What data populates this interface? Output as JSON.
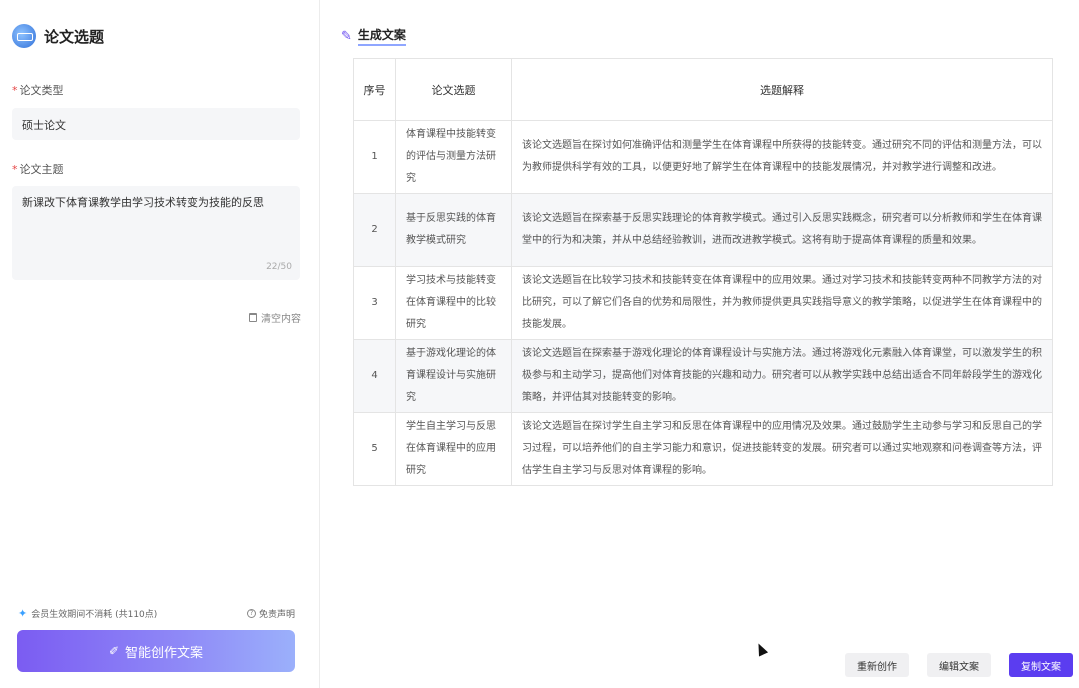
{
  "app": {
    "title": "论文选题"
  },
  "form": {
    "type_label": "论文类型",
    "type_value": "硕士论文",
    "topic_label": "论文主题",
    "topic_value": "新课改下体育课教学由学习技术转变为技能的反思",
    "counter": "22/50",
    "clear_label": "清空内容"
  },
  "footer": {
    "member_note": "会员生效期间不消耗 (共110点)",
    "disclaimer": "免责声明",
    "create_button": "智能创作文案"
  },
  "result": {
    "title": "生成文案",
    "columns": [
      "序号",
      "论文选题",
      "选题解释"
    ],
    "rows": [
      {
        "idx": "1",
        "topic": "体育课程中技能转变的评估与测量方法研究",
        "desc": "该论文选题旨在探讨如何准确评估和测量学生在体育课程中所获得的技能转变。通过研究不同的评估和测量方法，可以为教师提供科学有效的工具，以便更好地了解学生在体育课程中的技能发展情况，并对教学进行调整和改进。"
      },
      {
        "idx": "2",
        "topic": "基于反思实践的体育教学模式研究",
        "desc": "该论文选题旨在探索基于反思实践理论的体育教学模式。通过引入反思实践概念，研究者可以分析教师和学生在体育课堂中的行为和决策，并从中总结经验教训，进而改进教学模式。这将有助于提高体育课程的质量和效果。"
      },
      {
        "idx": "3",
        "topic": "学习技术与技能转变在体育课程中的比较研究",
        "desc": "该论文选题旨在比较学习技术和技能转变在体育课程中的应用效果。通过对学习技术和技能转变两种不同教学方法的对比研究，可以了解它们各自的优势和局限性，并为教师提供更具实践指导意义的教学策略，以促进学生在体育课程中的技能发展。"
      },
      {
        "idx": "4",
        "topic": "基于游戏化理论的体育课程设计与实施研究",
        "desc": "该论文选题旨在探索基于游戏化理论的体育课程设计与实施方法。通过将游戏化元素融入体育课堂，可以激发学生的积极参与和主动学习，提高他们对体育技能的兴趣和动力。研究者可以从教学实践中总结出适合不同年龄段学生的游戏化策略，并评估其对技能转变的影响。"
      },
      {
        "idx": "5",
        "topic": "学生自主学习与反思在体育课程中的应用研究",
        "desc": "该论文选题旨在探讨学生自主学习和反思在体育课程中的应用情况及效果。通过鼓励学生主动参与学习和反思自己的学习过程，可以培养他们的自主学习能力和意识，促进技能转变的发展。研究者可以通过实地观察和问卷调查等方法，评估学生自主学习与反思对体育课程的影响。"
      }
    ]
  },
  "actions": {
    "regenerate": "重新创作",
    "edit": "编辑文案",
    "copy": "复制文案"
  }
}
